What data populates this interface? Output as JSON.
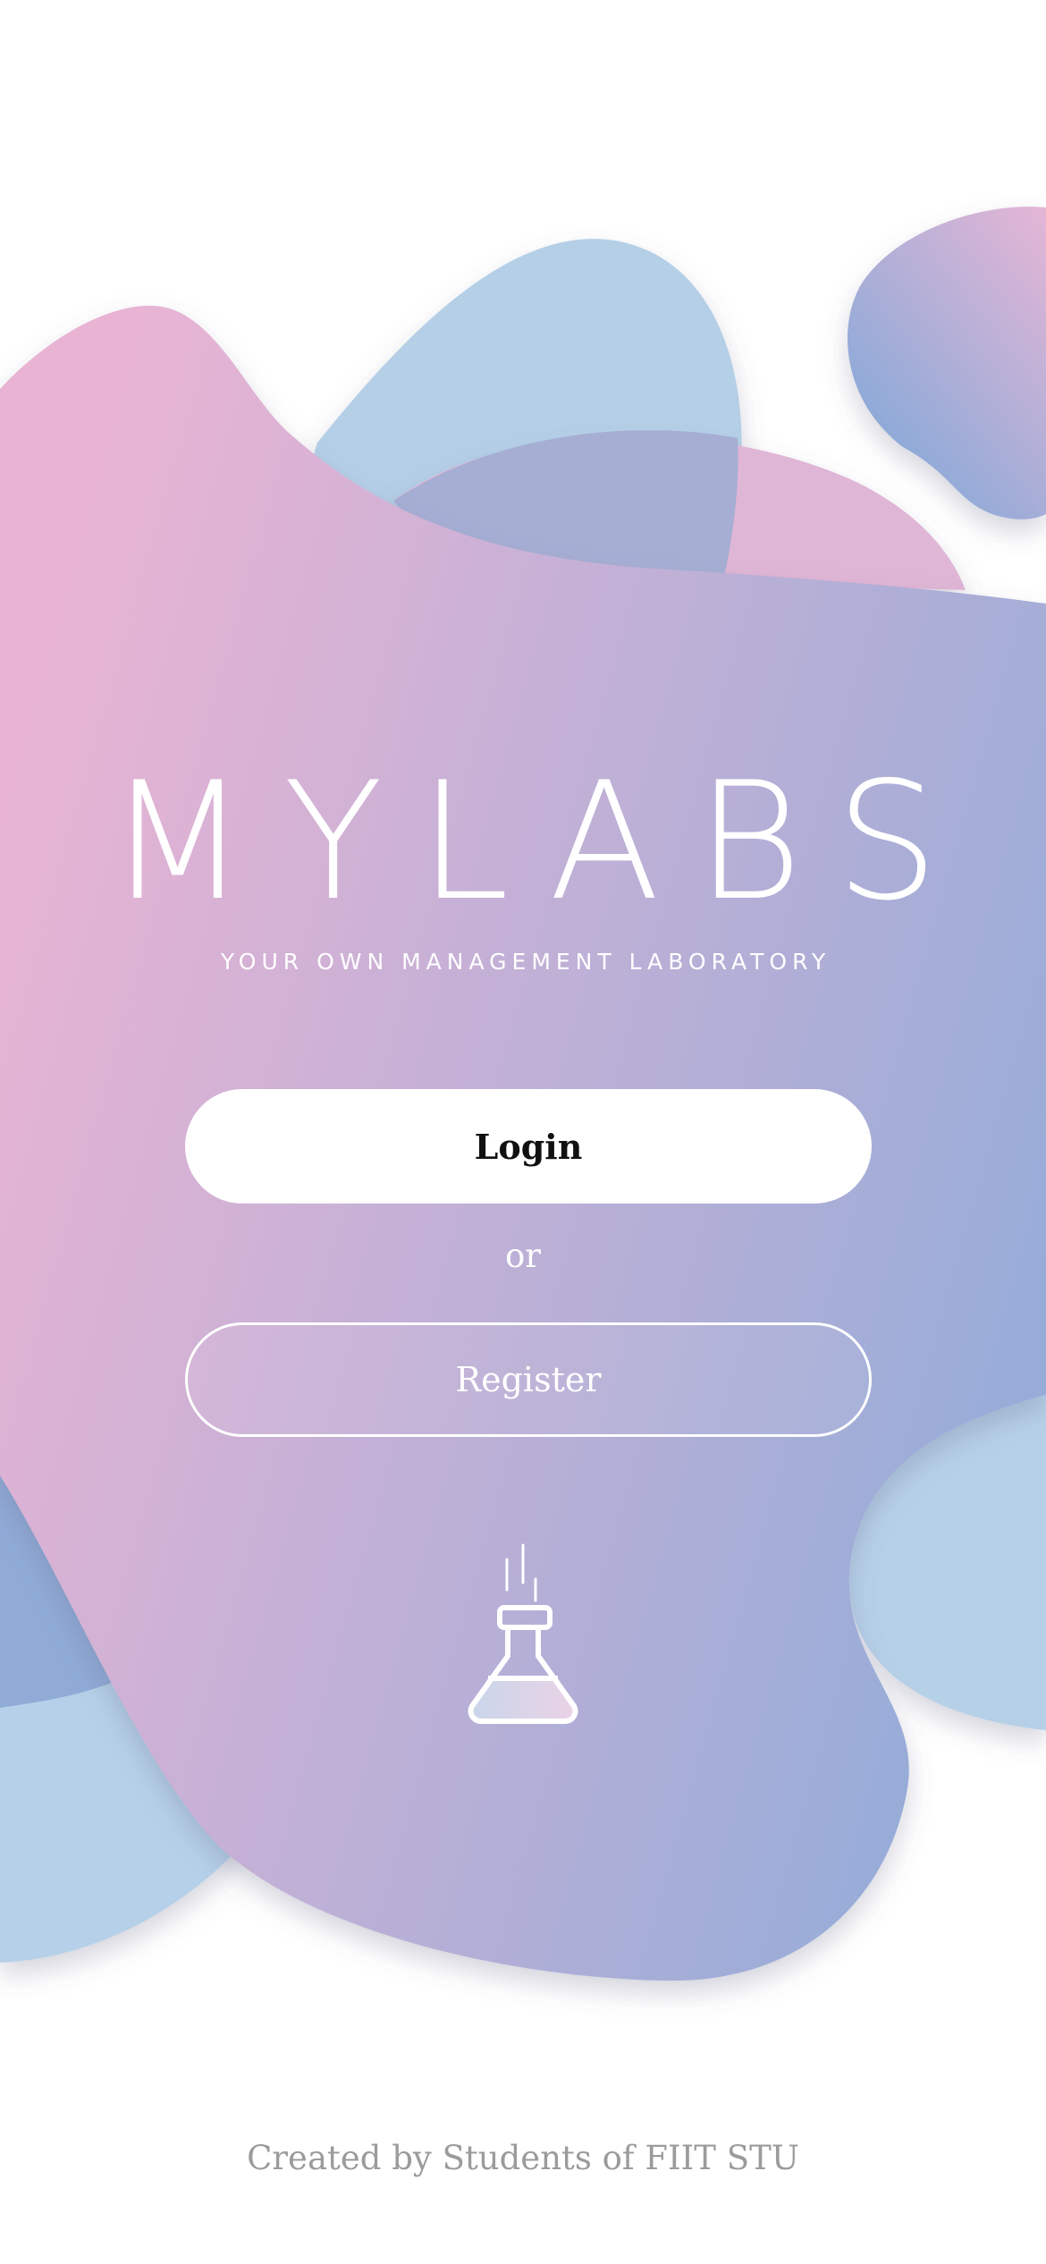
{
  "brand": {
    "title": "MYLABS",
    "subtitle": "YOUR OWN MANAGEMENT LABORATORY"
  },
  "actions": {
    "login_label": "Login",
    "separator": "or",
    "register_label": "Register"
  },
  "illustration": {
    "icon": "flask-icon"
  },
  "footer": {
    "credit": "Created by  Students of FIIT STU"
  },
  "colors": {
    "pink": "#e8b6d4",
    "lavender": "#c5b0d6",
    "periwinkle": "#96aed8",
    "sky_blue": "#b6d0e8",
    "footer_text": "#9b9b9b"
  }
}
